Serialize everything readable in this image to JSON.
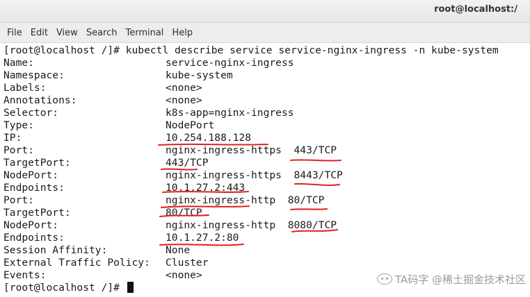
{
  "window": {
    "title": "root@localhost:/"
  },
  "menu": [
    "File",
    "Edit",
    "View",
    "Search",
    "Terminal",
    "Help"
  ],
  "terminal": {
    "command_line": "[root@localhost /]# kubectl describe service service-nginx-ingress -n kube-system",
    "fields": [
      {
        "key": "Name:",
        "value": "service-nginx-ingress"
      },
      {
        "key": "Namespace:",
        "value": "kube-system"
      },
      {
        "key": "Labels:",
        "value": "<none>"
      },
      {
        "key": "Annotations:",
        "value": "<none>"
      },
      {
        "key": "Selector:",
        "value": "k8s-app=nginx-ingress"
      },
      {
        "key": "Type:",
        "value": "NodePort"
      },
      {
        "key": "IP:",
        "value": "10.254.188.128"
      },
      {
        "key": "Port:",
        "value": "nginx-ingress-https  443/TCP"
      },
      {
        "key": "TargetPort:",
        "value": "443/TCP"
      },
      {
        "key": "NodePort:",
        "value": "nginx-ingress-https  8443/TCP"
      },
      {
        "key": "Endpoints:",
        "value": "10.1.27.2:443"
      },
      {
        "key": "Port:",
        "value": "nginx-ingress-http  80/TCP"
      },
      {
        "key": "TargetPort:",
        "value": "80/TCP"
      },
      {
        "key": "NodePort:",
        "value": "nginx-ingress-http  8080/TCP"
      },
      {
        "key": "Endpoints:",
        "value": "10.1.27.2:80"
      },
      {
        "key": "Session Affinity:",
        "value": "None"
      },
      {
        "key": "External Traffic Policy:",
        "value": "Cluster"
      },
      {
        "key": "Events:",
        "value": "<none>"
      }
    ],
    "prompt": "[root@localhost /]# "
  },
  "watermark": {
    "text": "TA码字 @稀土掘金技术社区"
  },
  "colors": {
    "annotation": "#e0201b",
    "text": "#1a1a1a",
    "menubar": "#ededed",
    "titlebar": "#e9e9e9"
  }
}
